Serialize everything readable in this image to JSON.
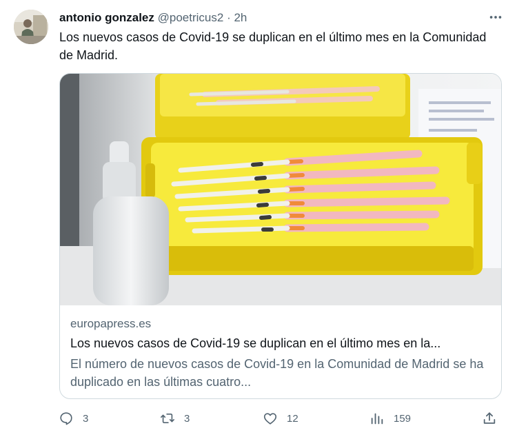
{
  "tweet": {
    "author_name": "antonio gonzalez",
    "handle": "@poetricus2",
    "separator": "·",
    "time": "2h",
    "text": "Los nuevos casos de Covid-19 se duplican en el último mes en la Comunidad de Madrid."
  },
  "card": {
    "domain": "europapress.es",
    "title": "Los nuevos casos de Covid-19 se duplican en el último mes en la...",
    "description": "El número de nuevos casos de Covid-19 en la Comunidad de Madrid se ha duplicado en las últimas cuatro...",
    "image_subject": "yellow trays with syringes and a white spray bottle"
  },
  "actions": {
    "replies": "3",
    "reposts": "3",
    "likes": "12",
    "views": "159"
  },
  "icons": [
    "more-icon",
    "reply-icon",
    "repost-icon",
    "like-icon",
    "views-icon",
    "share-icon"
  ],
  "colors": {
    "text": "#0f1419",
    "secondary": "#536471",
    "border": "#cfd9de",
    "tray": "#f4df1a"
  }
}
